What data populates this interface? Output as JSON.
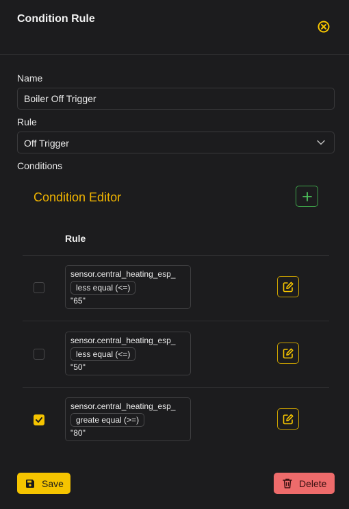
{
  "header": {
    "title": "Condition Rule",
    "close_icon": "close-circle-icon",
    "accent": "#f5c400"
  },
  "form": {
    "name_label": "Name",
    "name_value": "Boiler Off Trigger",
    "rule_label": "Rule",
    "rule_value": "Off Trigger",
    "conditions_label": "Conditions"
  },
  "editor": {
    "title": "Condition Editor",
    "column_rule": "Rule",
    "rows": [
      {
        "checked": false,
        "sensor": "sensor.central_heating_esp_",
        "operator": "less equal (<=)",
        "value": "\"65\""
      },
      {
        "checked": false,
        "sensor": "sensor.central_heating_esp_",
        "operator": "less equal (<=)",
        "value": "\"50\""
      },
      {
        "checked": true,
        "sensor": "sensor.central_heating_esp_",
        "operator": "greate equal (>=)",
        "value": "\"80\""
      }
    ]
  },
  "footer": {
    "save_label": "Save",
    "delete_label": "Delete",
    "save_color": "#f5c400",
    "delete_color": "#ee6b6b"
  }
}
